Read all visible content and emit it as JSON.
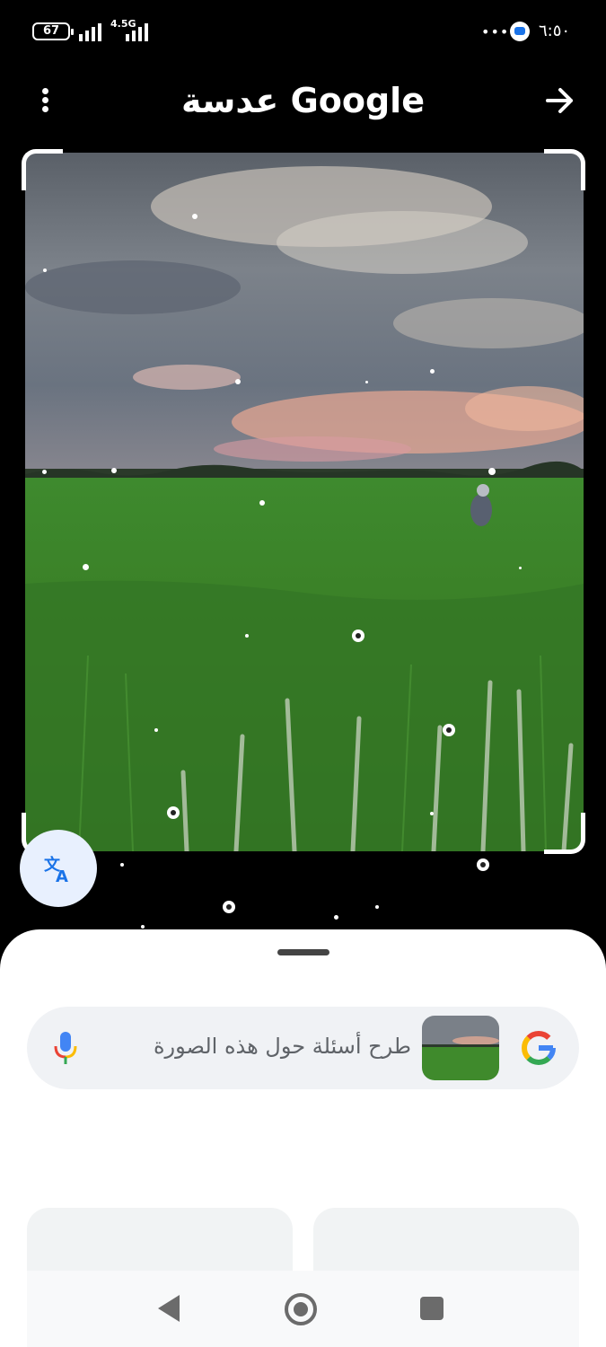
{
  "status_bar": {
    "battery": "67",
    "network_type": "4.5G",
    "overflow": "•••",
    "time": "٦:٥٠",
    "icons": [
      "battery-icon",
      "signal-icon",
      "signal-icon",
      "message-icon"
    ]
  },
  "app_bar": {
    "title": "عدسة Google",
    "menu_icon": "more-vert-icon",
    "forward_icon": "arrow-forward-icon"
  },
  "image_view": {
    "translate_icon": "translate-icon",
    "selection": "full-image"
  },
  "search": {
    "placeholder": "طرح أسئلة حول هذه الصورة",
    "mic_icon": "mic-icon",
    "logo_icon": "google-g-icon"
  },
  "colors": {
    "accent": "#1a73e8",
    "sheet_bg": "#ffffff",
    "search_bg": "#f0f2f5"
  },
  "nav": {
    "icons": [
      "back-icon",
      "home-icon",
      "recents-icon"
    ]
  }
}
